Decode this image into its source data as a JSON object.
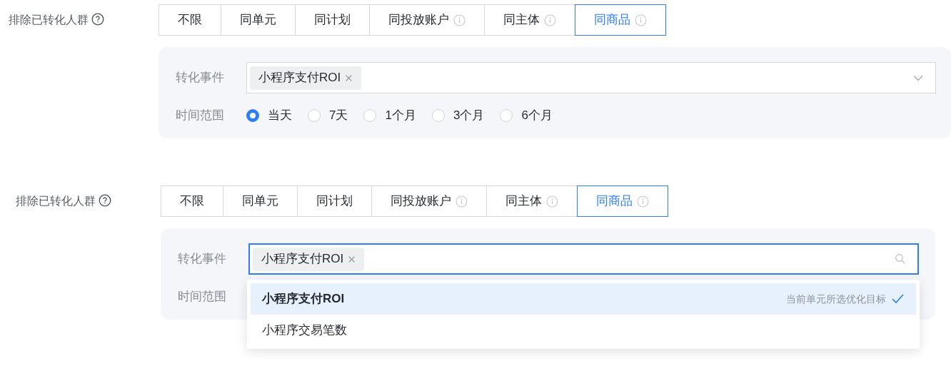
{
  "sections": [
    {
      "label": "排除已转化人群",
      "segments": [
        {
          "label": "不限",
          "info": false,
          "selected": false
        },
        {
          "label": "同单元",
          "info": false,
          "selected": false
        },
        {
          "label": "同计划",
          "info": false,
          "selected": false
        },
        {
          "label": "同投放账户",
          "info": true,
          "selected": false
        },
        {
          "label": "同主体",
          "info": true,
          "selected": false
        },
        {
          "label": "同商品",
          "info": true,
          "selected": true
        }
      ],
      "event_label": "转化事件",
      "event_field": {
        "focused": false,
        "tags": [
          "小程序支付ROI"
        ]
      },
      "time_label": "时间范围",
      "time_options": [
        {
          "label": "当天",
          "selected": true
        },
        {
          "label": "7天",
          "selected": false
        },
        {
          "label": "1个月",
          "selected": false
        },
        {
          "label": "3个月",
          "selected": false
        },
        {
          "label": "6个月",
          "selected": false
        }
      ]
    },
    {
      "label": "排除已转化人群",
      "segments": [
        {
          "label": "不限",
          "info": false,
          "selected": false
        },
        {
          "label": "同单元",
          "info": false,
          "selected": false
        },
        {
          "label": "同计划",
          "info": false,
          "selected": false
        },
        {
          "label": "同投放账户",
          "info": true,
          "selected": false
        },
        {
          "label": "同主体",
          "info": true,
          "selected": false
        },
        {
          "label": "同商品",
          "info": true,
          "selected": true
        }
      ],
      "event_label": "转化事件",
      "event_field": {
        "focused": true,
        "tags": [
          "小程序支付ROI"
        ]
      },
      "time_label": "时间范围",
      "dropdown": [
        {
          "label": "小程序支付ROI",
          "selected": true,
          "hint": "当前单元所选优化目标"
        },
        {
          "label": "小程序交易笔数",
          "selected": false
        }
      ]
    }
  ]
}
